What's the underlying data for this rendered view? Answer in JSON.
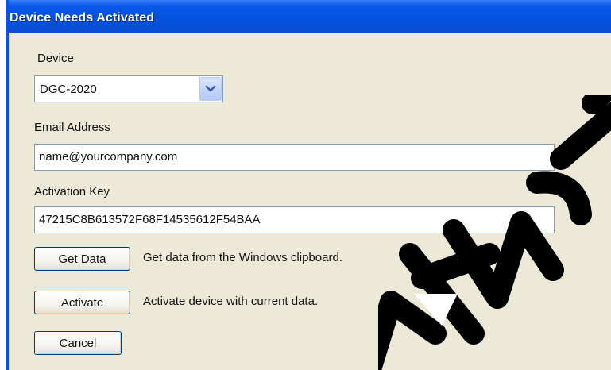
{
  "window": {
    "title": "Device Needs Activated"
  },
  "device": {
    "label": "Device",
    "selected": "DGC-2020"
  },
  "email": {
    "label": "Email Address",
    "value": "name@yourcompany.com"
  },
  "activation": {
    "label": "Activation Key",
    "value": "47215C8B613572F68F14535612F54BAA"
  },
  "buttons": {
    "get_data": {
      "label": "Get Data",
      "description": "Get data from the Windows clipboard."
    },
    "activate": {
      "label": "Activate",
      "description": "Activate device with current data."
    },
    "cancel": {
      "label": "Cancel"
    }
  },
  "colors": {
    "titlebar": "#0a58e8",
    "dialog_bg": "#ece9d8",
    "button_border": "#003c74",
    "field_border": "#7f9db9",
    "watermark": "#000000"
  },
  "icons": {
    "dropdown": "chevron-down-icon"
  }
}
